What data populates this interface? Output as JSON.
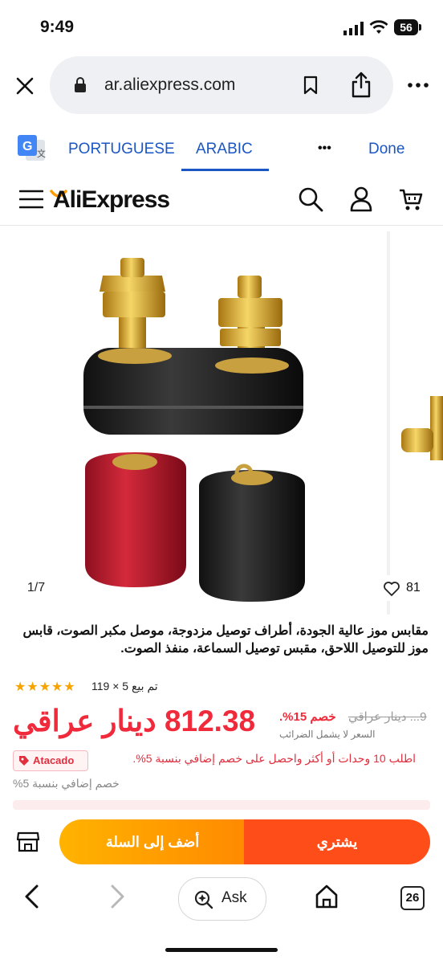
{
  "status_bar": {
    "time": "9:49",
    "battery": "56"
  },
  "browser": {
    "url": "ar.aliexpress.com",
    "translate": {
      "lang1": "PORTUGUESE",
      "lang2": "ARABIC",
      "more": "•••",
      "done": "Done"
    },
    "tab_count": "26",
    "ask_label": "Ask"
  },
  "site": {
    "logo": "AliExpress"
  },
  "gallery": {
    "counter": "1/7",
    "likes": "81"
  },
  "product": {
    "title": "مقابس موز عالية الجودة، أطراف توصيل مزدوجة، موصل مكبر الصوت، قابس موز للتوصيل اللاحق، مقبس توصيل السماعة، منفذ الصوت.",
    "rating_stars": 5,
    "sold_text": "تم بيع 5 × 119",
    "price": "812.38 دينار عراقي",
    "old_price": "9... دينار عراقي",
    "discount": "خصم 15%.",
    "tax_note": "السعر لا يشمل الضرائب",
    "atacado": "Atacado",
    "bulk_offer": "اطلب 10 وحدات أو أكثر واحصل على خصم إضافي بنسبة 5%.",
    "extra_discount": "خصم إضافي بنسبة 5%"
  },
  "actions": {
    "add_to_cart": "أضف إلى السلة",
    "buy_now": "يشتري"
  },
  "colors": {
    "price_red": "#f02a3a",
    "buy_orange": "#ff4d1a",
    "cart_yellow": "#ffb300",
    "translate_blue": "#1a56c4"
  }
}
